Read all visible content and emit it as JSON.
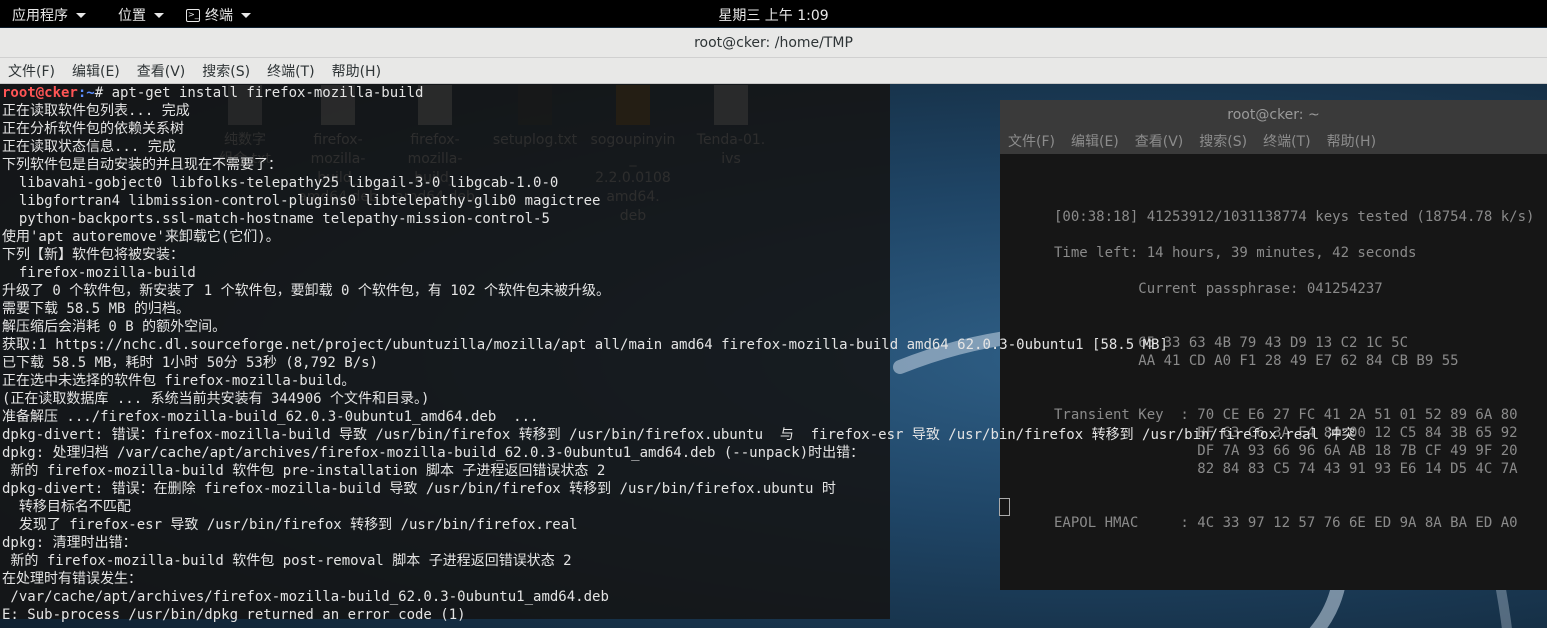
{
  "topbar": {
    "applications": "应用程序",
    "places": "位置",
    "terminal": "终端",
    "clock": "星期三 上午 1:09"
  },
  "window": {
    "title": "root@cker: /home/TMP",
    "menu": [
      "文件(F)",
      "编辑(E)",
      "查看(V)",
      "搜索(S)",
      "终端(T)",
      "帮助(H)"
    ]
  },
  "desktop_icons": [
    {
      "label": "纯数字\n组合.txt"
    },
    {
      "label": "firefox-\nmozilla-\nbuild_\namd64.deb"
    },
    {
      "label": "firefox-\nmozilla-\nbuild_\namd64.deb"
    },
    {
      "label": "setuplog.txt"
    },
    {
      "label": "sogoupinyin\n_\n2.2.0.0108\namd64.\ndeb"
    },
    {
      "label": "Tenda-01.\nivs"
    }
  ],
  "bg_terminal": {
    "title": "root@cker: ~",
    "menu": [
      "文件(F)",
      "编辑(E)",
      "查看(V)",
      "搜索(S)",
      "终端(T)",
      "帮助(H)"
    ],
    "lines": [
      "",
      "",
      "",
      "[00:38:18] 41253912/1031138774 keys tested (18754.78 k/s)",
      "",
      "Time left: 14 hours, 39 minutes, 42 seconds",
      "",
      "          Current passphrase: 041254237",
      "",
      "",
      "          65 33 63 4B 79 43 D9 13 C2 1C 5C",
      "          AA 41 CD A0 F1 28 49 E7 62 84 CB B9 55",
      "",
      "",
      "Transient Key  : 70 CE E6 27 FC 41 2A 51 01 52 89 6A 80",
      "                 BF 63 C6 3A E4 84 00 12 C5 84 3B 65 92",
      "                 DF 7A 93 66 96 6A AB 18 7B CF 49 9F 20",
      "                 82 84 83 C5 74 43 91 93 E6 14 D5 4C 7A",
      "",
      "",
      "EAPOL HMAC     : 4C 33 97 12 57 76 6E ED 9A 8A BA ED A0"
    ]
  },
  "terminal": {
    "prompt_user": "root@cker",
    "prompt_path": ":~",
    "command": "# apt-get install firefox-mozilla-build",
    "output": [
      "正在读取软件包列表... 完成",
      "正在分析软件包的依赖关系树",
      "正在读取状态信息... 完成",
      "下列软件包是自动安装的并且现在不需要了：",
      "  libavahi-gobject0 libfolks-telepathy25 libgail-3-0 libgcab-1.0-0",
      "  libgfortran4 libmission-control-plugins0 libtelepathy-glib0 magictree",
      "  python-backports.ssl-match-hostname telepathy-mission-control-5",
      "使用'apt autoremove'来卸载它(它们)。",
      "下列【新】软件包将被安装：",
      "  firefox-mozilla-build",
      "升级了 0 个软件包，新安装了 1 个软件包，要卸载 0 个软件包，有 102 个软件包未被升级。",
      "需要下载 58.5 MB 的归档。",
      "解压缩后会消耗 0 B 的额外空间。",
      "获取:1 https://nchc.dl.sourceforge.net/project/ubuntuzilla/mozilla/apt all/main amd64 firefox-mozilla-build amd64 62.0.3-0ubuntu1 [58.5 MB]",
      "已下载 58.5 MB，耗时 1小时 50分 53秒 (8,792 B/s)",
      "正在选中未选择的软件包 firefox-mozilla-build。",
      "(正在读取数据库 ... 系统当前共安装有 344906 个文件和目录。)",
      "准备解压 .../firefox-mozilla-build_62.0.3-0ubuntu1_amd64.deb  ...",
      "dpkg-divert: 错误：firefox-mozilla-build 导致 /usr/bin/firefox 转移到 /usr/bin/firefox.ubuntu  与  firefox-esr 导致 /usr/bin/firefox 转移到 /usr/bin/firefox.real 冲突",
      "dpkg: 处理归档 /var/cache/apt/archives/firefox-mozilla-build_62.0.3-0ubuntu1_amd64.deb (--unpack)时出错：",
      " 新的 firefox-mozilla-build 软件包 pre-installation 脚本 子进程返回错误状态 2",
      "dpkg-divert: 错误：在删除 firefox-mozilla-build 导致 /usr/bin/firefox 转移到 /usr/bin/firefox.ubuntu 时",
      "  转移目标名不匹配",
      "  发现了 firefox-esr 导致 /usr/bin/firefox 转移到 /usr/bin/firefox.real",
      "dpkg: 清理时出错：",
      " 新的 firefox-mozilla-build 软件包 post-removal 脚本 子进程返回错误状态 2",
      "在处理时有错误发生：",
      " /var/cache/apt/archives/firefox-mozilla-build_62.0.3-0ubuntu1_amd64.deb",
      "E: Sub-process /usr/bin/dpkg returned an error code (1)"
    ]
  }
}
